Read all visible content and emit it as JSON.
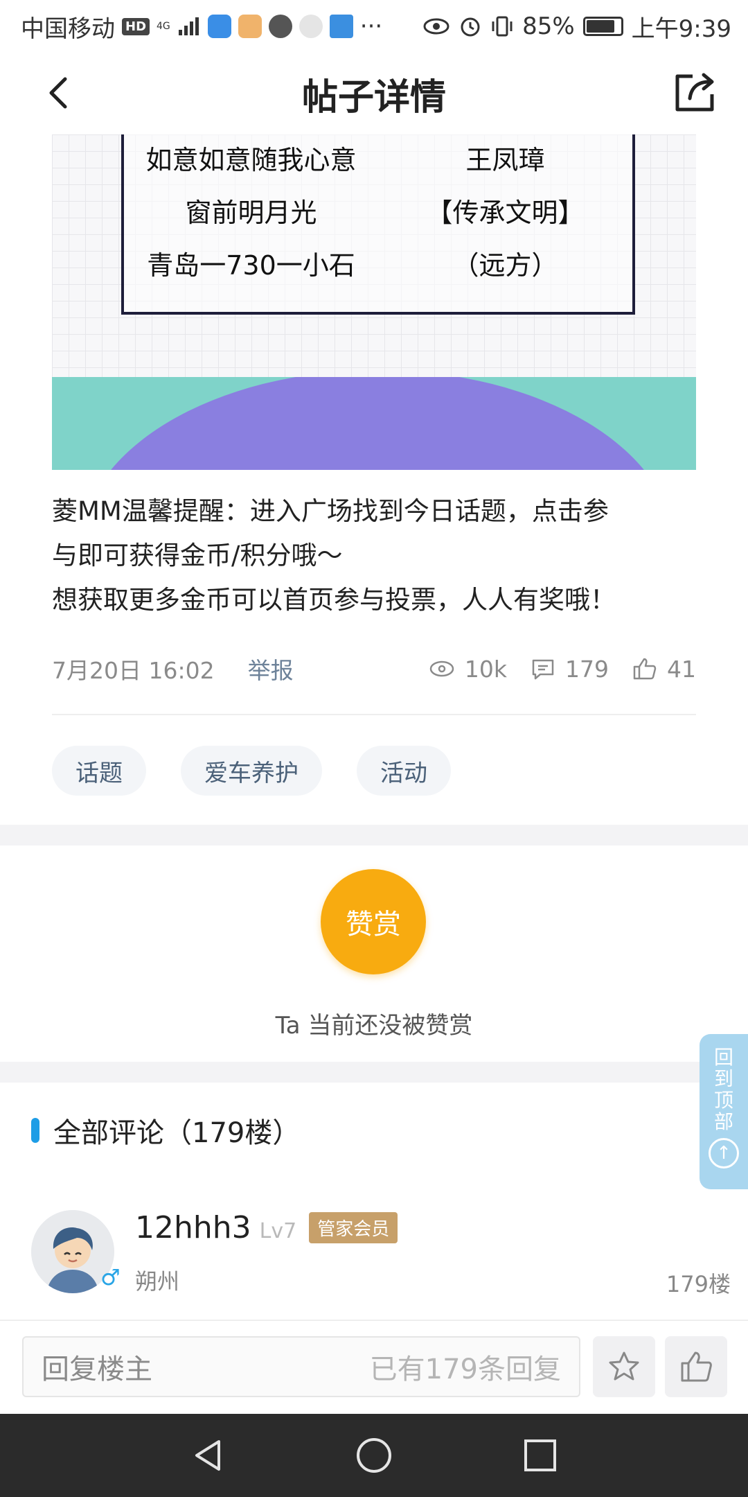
{
  "status_bar": {
    "carrier": "中国移动",
    "hd_badge": "HD",
    "network": "4G",
    "more": "···",
    "battery": "85%",
    "battery_level": 0.85,
    "time": "上午9:39"
  },
  "header": {
    "title": "帖子详情"
  },
  "poster": {
    "names": [
      "如意如意随我心意",
      "王凤璋",
      "窗前明月光",
      "【传承文明】",
      "青岛一730一小石",
      "（远方）"
    ],
    "colors": {
      "teal": "#7fd3c9",
      "purple": "#8a7fe0",
      "frame": "#1e1e3a"
    }
  },
  "post": {
    "line1": "菱MM温馨提醒：进入广场找到今日话题，点击参",
    "line2": "与即可获得金币/积分哦～",
    "line3": "想获取更多金币可以首页参与投票，人人有奖哦！",
    "date": "7月20日 16:02",
    "report": "举报",
    "views": "10k",
    "comments": "179",
    "likes": "41"
  },
  "tags": [
    "话题",
    "爱车养护",
    "活动"
  ],
  "reward": {
    "button": "赞赏",
    "status": "Ta 当前还没被赞赏",
    "color": "#f8ab10"
  },
  "back_to_top": {
    "label": "回到顶部",
    "arrow": "↑"
  },
  "comments": {
    "header": "全部评论（179楼）",
    "accent": "#1e9de6",
    "items": [
      {
        "name": "12hhh3",
        "level": "Lv7",
        "badge": "管家会员",
        "gender": "♂",
        "location": "朔州",
        "floor": "179楼"
      }
    ]
  },
  "reply_bar": {
    "placeholder": "回复楼主",
    "count": "已有179条回复"
  }
}
